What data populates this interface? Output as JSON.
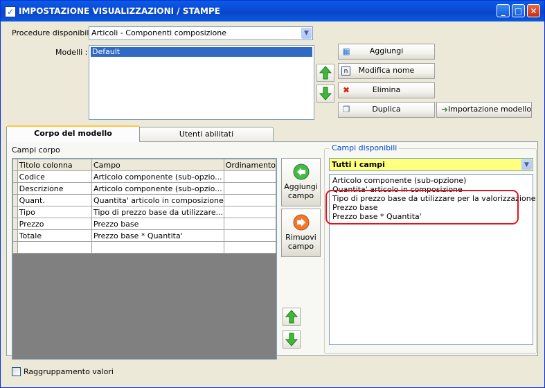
{
  "window": {
    "title": "IMPOSTAZIONE VISUALIZZAZIONI / STAMPE",
    "controls": {
      "minimize": "_",
      "maximize": "□",
      "close": "✕"
    }
  },
  "procedure": {
    "label": "Procedure disponibili :",
    "selected": "Articoli - Componenti composizione"
  },
  "modelli": {
    "label": "Modelli :",
    "items": [
      "Default"
    ]
  },
  "buttons": {
    "aggiungi": "Aggiungi",
    "modifica_nome": "Modifica nome",
    "elimina": "Elimina",
    "duplica": "Duplica",
    "importazione_modello": "Importazione modello"
  },
  "tabs": [
    {
      "label": "Corpo del modello",
      "active": true
    },
    {
      "label": "Utenti abilitati",
      "active": false
    }
  ],
  "campi_corpo": {
    "label": "Campi corpo",
    "columns": [
      "Titolo colonna",
      "Campo",
      "Ordinamento"
    ],
    "rows": [
      [
        "Codice",
        "Articolo componente (sub-opzio...",
        ""
      ],
      [
        "Descrizione",
        "Articolo componente (sub-opzio...",
        ""
      ],
      [
        "Quant.",
        "Quantita' articolo in composizione",
        ""
      ],
      [
        "Tipo",
        "Tipo di prezzo base da utilizzare...",
        ""
      ],
      [
        "Prezzo",
        "Prezzo base",
        ""
      ],
      [
        "Totale",
        "Prezzo base * Quantita'",
        ""
      ],
      [
        "",
        "",
        ""
      ]
    ]
  },
  "side_buttons": {
    "aggiungi_campo": [
      "Aggiungi",
      "campo"
    ],
    "rimuovi_campo": [
      "Rimuovi",
      "campo"
    ]
  },
  "campi_disponibili": {
    "label": "Campi disponibili",
    "filter": "Tutti i campi",
    "items": [
      "Articolo componente (sub-opzione)",
      "Quantita' articolo in composizione",
      "Tipo di prezzo base da utilizzare per la valorizzazione",
      "Prezzo base",
      "Prezzo base * Quantita'"
    ]
  },
  "raggruppamento": {
    "label": "Raggruppamento valori",
    "checked": false
  },
  "colors": {
    "selection": "#316ac5",
    "title_bar": "#0a5ce7",
    "annotation": "#e8101a"
  }
}
